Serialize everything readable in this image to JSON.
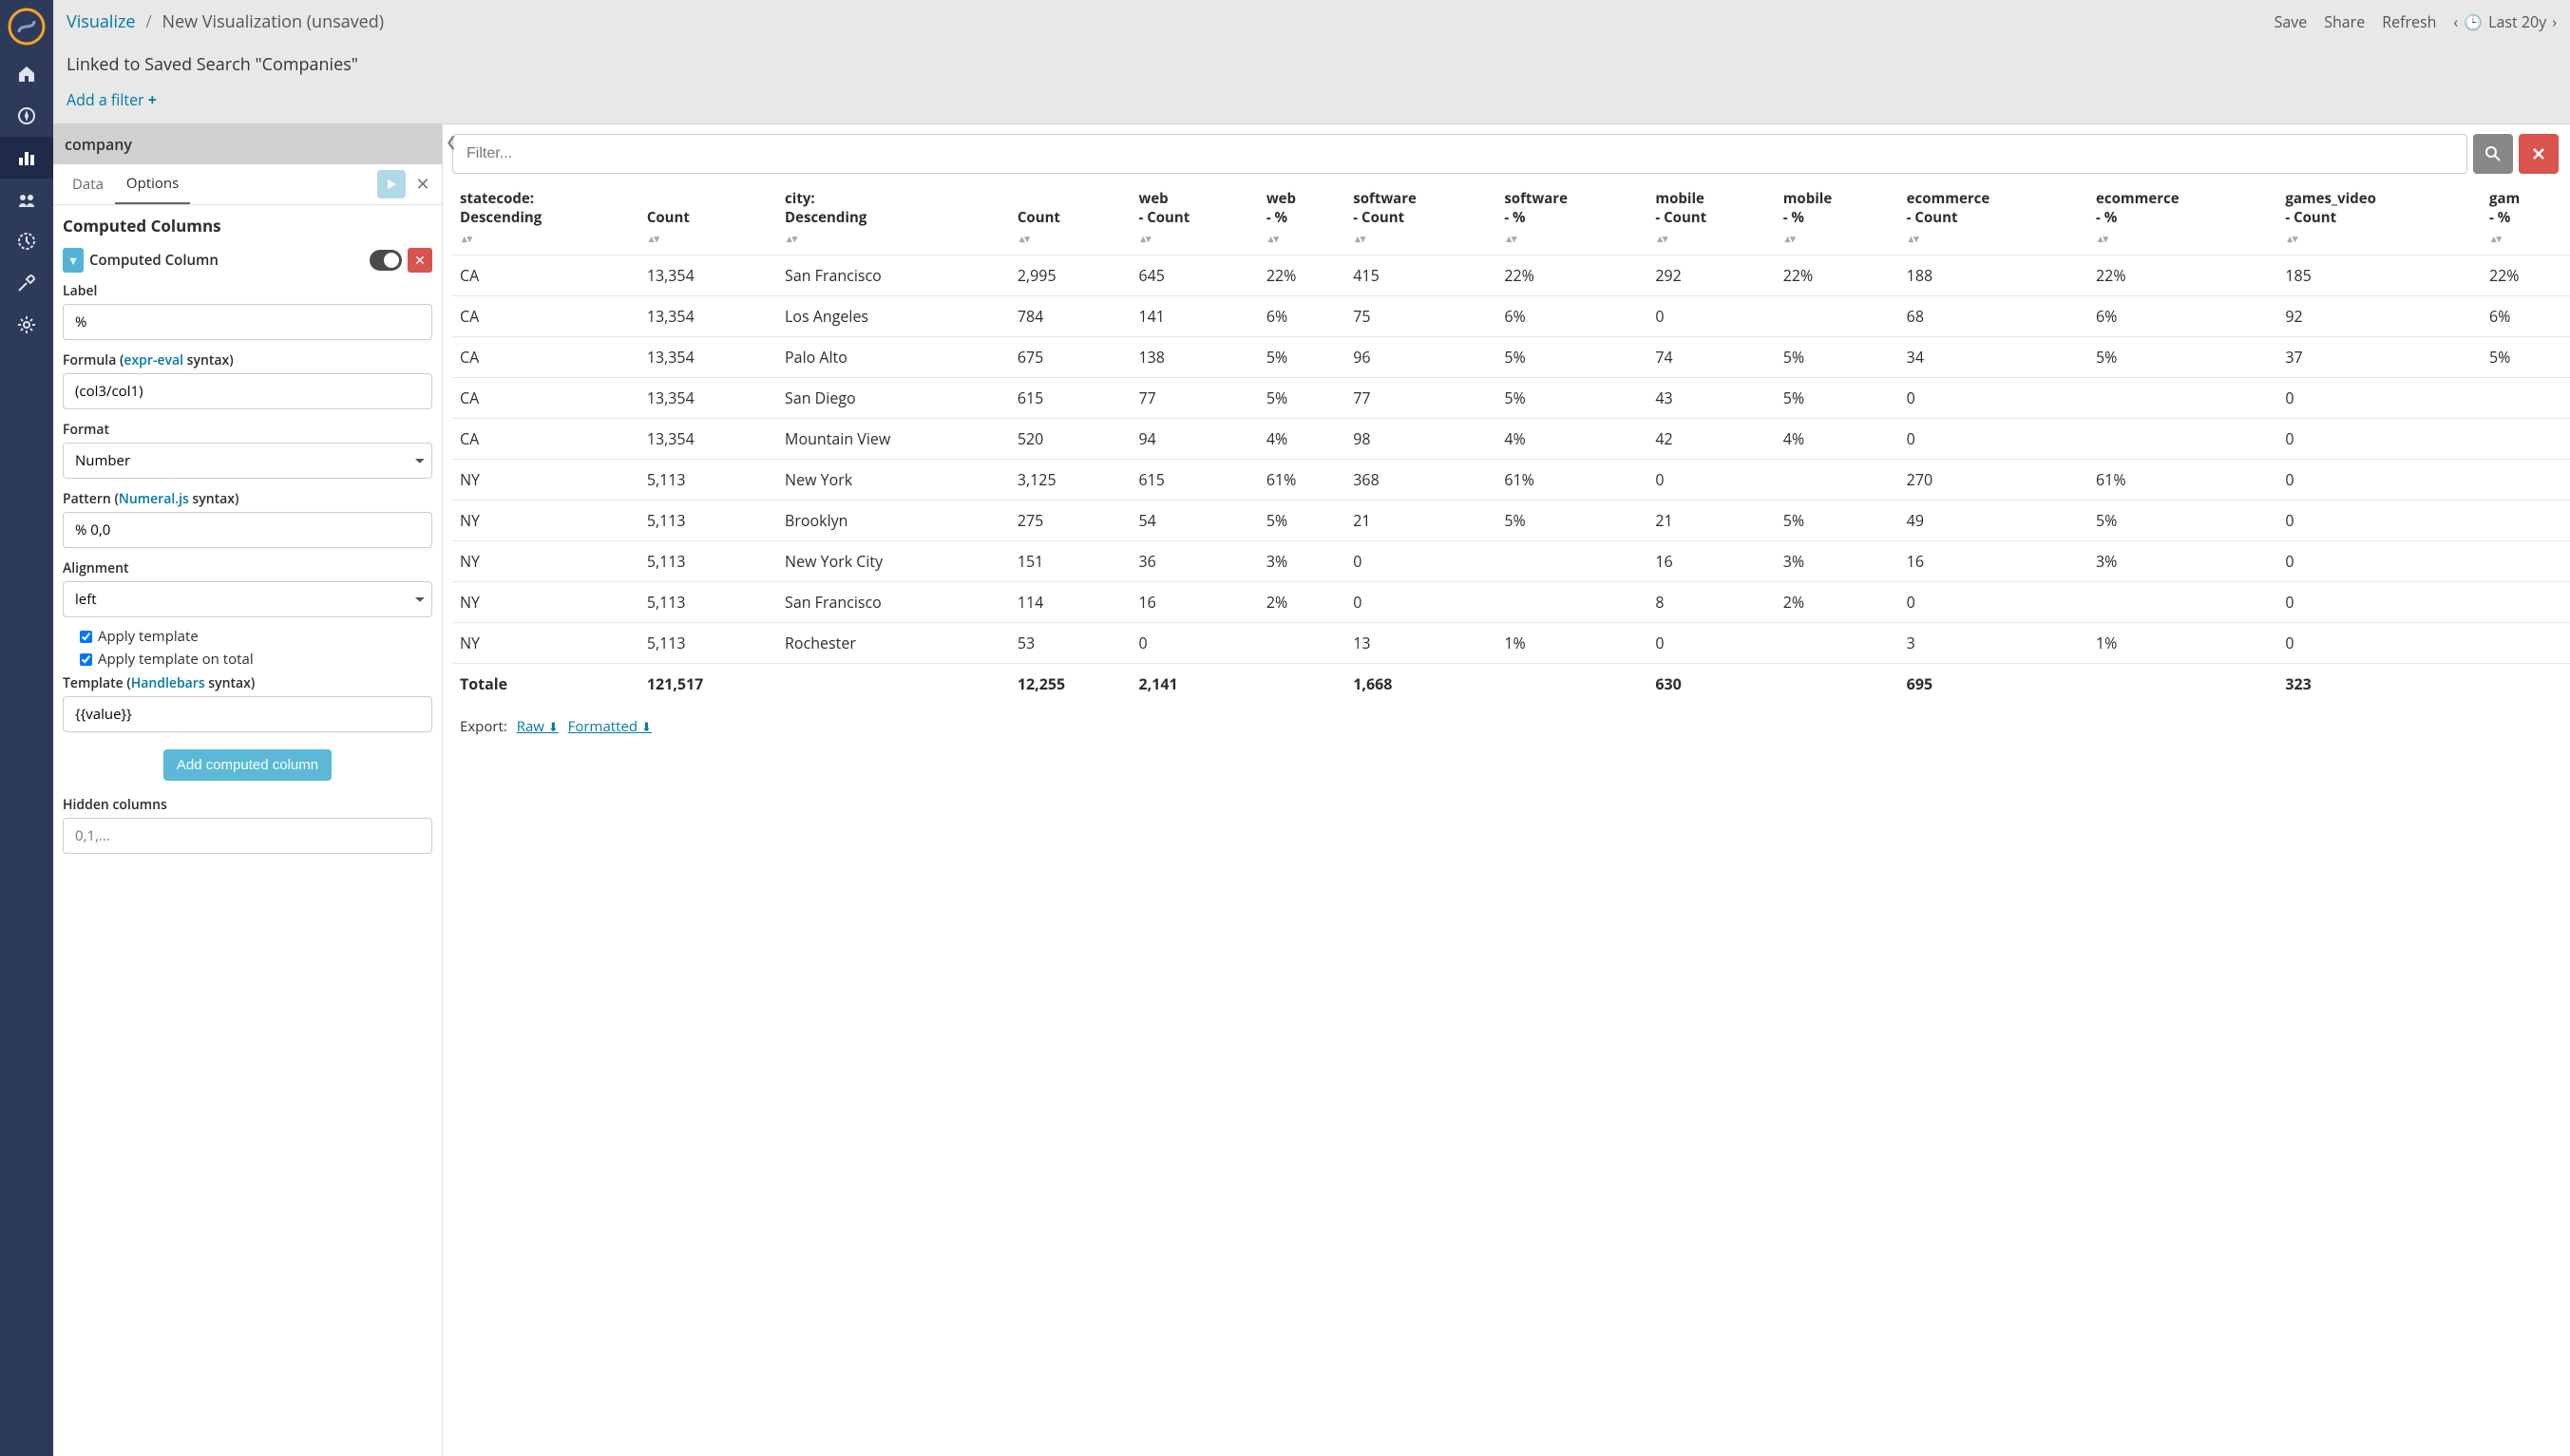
{
  "breadcrumb": {
    "root": "Visualize",
    "current": "New Visualization (unsaved)"
  },
  "topbar": {
    "linked": "Linked to Saved Search \"Companies\"",
    "addFilter": "Add a filter",
    "actions": {
      "save": "Save",
      "share": "Share",
      "refresh": "Refresh",
      "timeRange": "Last 20y"
    }
  },
  "config": {
    "indexPattern": "company",
    "tabs": {
      "data": "Data",
      "options": "Options"
    },
    "section": "Computed Columns",
    "computedColumn": {
      "title": "Computed Column",
      "labelLabel": "Label",
      "labelValue": "%",
      "formulaLabel": "Formula (",
      "formulaLink": "expr-eval",
      "formulaSuffix": " syntax)",
      "formulaValue": "(col3/col1)",
      "formatLabel": "Format",
      "formatValue": "Number",
      "patternLabel": "Pattern (",
      "patternLink": "Numeral.js",
      "patternSuffix": " syntax)",
      "patternValue": "% 0,0",
      "alignmentLabel": "Alignment",
      "alignmentValue": "left",
      "applyTemplate": "Apply template",
      "applyTemplateTotal": "Apply template on total",
      "templateLabel": "Template (",
      "templateLink": "Handlebars",
      "templateSuffix": " syntax)",
      "templateValue": "{{value}}",
      "addBtn": "Add computed column",
      "hiddenColsLabel": "Hidden columns",
      "hiddenColsPlaceholder": "0,1,..."
    }
  },
  "viz": {
    "filterPlaceholder": "Filter...",
    "headers": [
      "statecode: Descending",
      "Count",
      "city: Descending",
      "Count",
      "web - Count",
      "web - %",
      "software - Count",
      "software - %",
      "mobile - Count",
      "mobile - %",
      "ecommerce - Count",
      "ecommerce - %",
      "games_video - Count",
      "gam - %"
    ],
    "rows": [
      [
        "CA",
        "13,354",
        "San Francisco",
        "2,995",
        "645",
        "22%",
        "415",
        "22%",
        "292",
        "22%",
        "188",
        "22%",
        "185",
        "22%"
      ],
      [
        "CA",
        "13,354",
        "Los Angeles",
        "784",
        "141",
        "6%",
        "75",
        "6%",
        "0",
        "",
        "68",
        "6%",
        "92",
        "6%"
      ],
      [
        "CA",
        "13,354",
        "Palo Alto",
        "675",
        "138",
        "5%",
        "96",
        "5%",
        "74",
        "5%",
        "34",
        "5%",
        "37",
        "5%"
      ],
      [
        "CA",
        "13,354",
        "San Diego",
        "615",
        "77",
        "5%",
        "77",
        "5%",
        "43",
        "5%",
        "0",
        "",
        "0",
        ""
      ],
      [
        "CA",
        "13,354",
        "Mountain View",
        "520",
        "94",
        "4%",
        "98",
        "4%",
        "42",
        "4%",
        "0",
        "",
        "0",
        ""
      ],
      [
        "NY",
        "5,113",
        "New York",
        "3,125",
        "615",
        "61%",
        "368",
        "61%",
        "0",
        "",
        "270",
        "61%",
        "0",
        ""
      ],
      [
        "NY",
        "5,113",
        "Brooklyn",
        "275",
        "54",
        "5%",
        "21",
        "5%",
        "21",
        "5%",
        "49",
        "5%",
        "0",
        ""
      ],
      [
        "NY",
        "5,113",
        "New York City",
        "151",
        "36",
        "3%",
        "0",
        "",
        "16",
        "3%",
        "16",
        "3%",
        "0",
        ""
      ],
      [
        "NY",
        "5,113",
        "San Francisco",
        "114",
        "16",
        "2%",
        "0",
        "",
        "8",
        "2%",
        "0",
        "",
        "0",
        ""
      ],
      [
        "NY",
        "5,113",
        "Rochester",
        "53",
        "0",
        "",
        "13",
        "1%",
        "0",
        "",
        "3",
        "1%",
        "0",
        ""
      ]
    ],
    "total": [
      "Totale",
      "121,517",
      "",
      "12,255",
      "2,141",
      "",
      "1,668",
      "",
      "630",
      "",
      "695",
      "",
      "323",
      ""
    ],
    "export": {
      "label": "Export:",
      "raw": "Raw",
      "formatted": "Formatted"
    }
  }
}
